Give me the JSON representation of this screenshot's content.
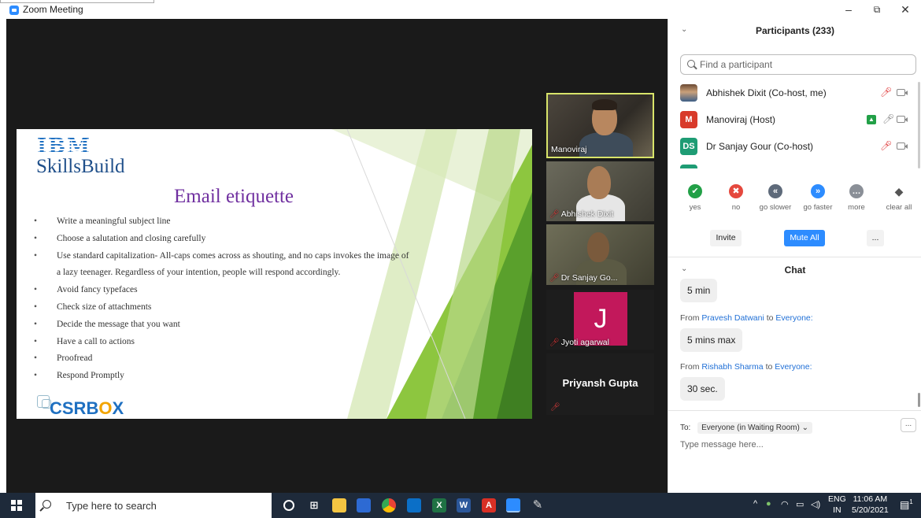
{
  "window": {
    "title": "Zoom Meeting",
    "minimize": "–",
    "restore": "⧉",
    "close": "✕"
  },
  "slide": {
    "logo_top": "IBM",
    "logo_bottom": "SkillsBuild",
    "title": "Email etiquette",
    "bullets": [
      "Write a meaningful subject line",
      "Choose a salutation and closing carefully",
      "Use standard capitalization- All-caps comes across as shouting, and no caps invokes the image of",
      "Avoid fancy typefaces",
      "Check size of attachments",
      "Decide the message that you want",
      "Have a call to actions",
      "Proofread",
      "Respond Promptly"
    ],
    "bullet3_cont": "a lazy teenager. Regardless of your intention, people will respond accordingly.",
    "footer_logo_a": "CSRB",
    "footer_logo_o": "O",
    "footer_logo_x": "X"
  },
  "video_tiles": [
    {
      "name": "Manoviraj"
    },
    {
      "name": "Abhishek Dixit"
    },
    {
      "name": "Dr Sanjay Go..."
    },
    {
      "name": "Jyoti agarwal",
      "initial": "J"
    },
    {
      "name": "Priyansh Gupta"
    }
  ],
  "participants": {
    "title": "Participants (233)",
    "search_placeholder": "Find a participant",
    "list": [
      {
        "name": "Abhishek Dixit (Co-host, me)"
      },
      {
        "name": "Manoviraj (Host)",
        "initials": "M"
      },
      {
        "name": "Dr Sanjay Gour (Co-host)",
        "initials": "DS"
      }
    ],
    "reactions": [
      {
        "label": "yes",
        "glyph": "✔"
      },
      {
        "label": "no",
        "glyph": "✖"
      },
      {
        "label": "go slower",
        "glyph": "«"
      },
      {
        "label": "go faster",
        "glyph": "»"
      },
      {
        "label": "more",
        "glyph": "…"
      },
      {
        "label": "clear all",
        "glyph": "◆"
      }
    ],
    "invite": "Invite",
    "mute_all": "Mute All",
    "more": "..."
  },
  "chat": {
    "title": "Chat",
    "messages": [
      {
        "text": "5 min"
      },
      {
        "from": "Pravesh Datwani",
        "to": "Everyone:",
        "text": "5 mins max"
      },
      {
        "from": "Rishabh Sharma",
        "to": "Everyone:",
        "text": "30 sec."
      }
    ],
    "from_word": "From",
    "to_word": "to",
    "to_label": "To:",
    "to_value": "Everyone (in Waiting Room) ⌄",
    "more": "...",
    "input_placeholder": "Type message here..."
  },
  "taskbar": {
    "search_placeholder": "Type here to search",
    "lang_top": "ENG",
    "lang_bottom": "IN",
    "time": "11:06 AM",
    "date": "5/20/2021",
    "notification_count": "1"
  },
  "colors": {
    "zoom_blue": "#2d8cff",
    "taskbar": "#1e2a3a",
    "slide_green": "#8dc63f",
    "title_purple": "#7030a0"
  }
}
